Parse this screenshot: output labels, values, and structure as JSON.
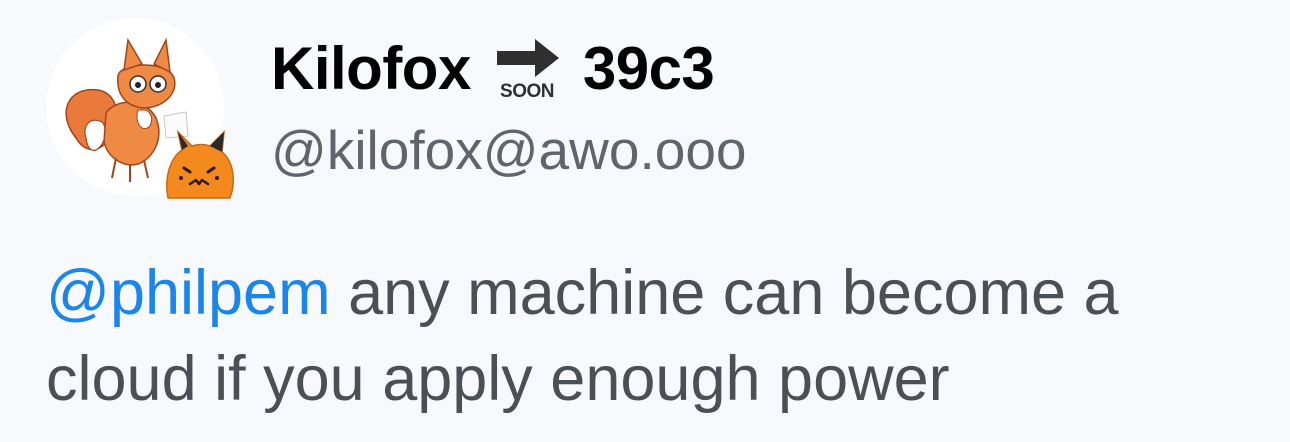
{
  "author": {
    "name_left": "Kilofox",
    "name_right": "39c3",
    "name_emoji": "soon-arrow-icon",
    "emoji_label": "SOON",
    "handle": "@kilofox@awo.ooo",
    "avatar": "fox-avatar",
    "avatar_badge": "blobfox-emoji"
  },
  "post": {
    "mention": "@philpem",
    "text": " any machine can become a cloud if you apply enough power"
  },
  "colors": {
    "background": "#f8f9fc",
    "mention": "#1a85ea",
    "body_text": "#4b4f56",
    "handle": "#60646c"
  }
}
